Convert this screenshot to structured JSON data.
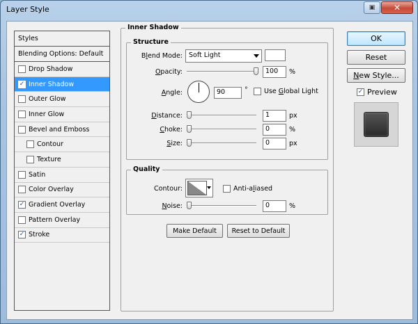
{
  "window": {
    "title": "Layer Style"
  },
  "styles_panel": {
    "header": "Styles",
    "blending": "Blending Options: Default",
    "items": [
      {
        "label": "Drop Shadow",
        "checked": false,
        "selected": false,
        "indent": false
      },
      {
        "label": "Inner Shadow",
        "checked": true,
        "selected": true,
        "indent": false
      },
      {
        "label": "Outer Glow",
        "checked": false,
        "selected": false,
        "indent": false
      },
      {
        "label": "Inner Glow",
        "checked": false,
        "selected": false,
        "indent": false
      },
      {
        "label": "Bevel and Emboss",
        "checked": false,
        "selected": false,
        "indent": false
      },
      {
        "label": "Contour",
        "checked": false,
        "selected": false,
        "indent": true
      },
      {
        "label": "Texture",
        "checked": false,
        "selected": false,
        "indent": true
      },
      {
        "label": "Satin",
        "checked": false,
        "selected": false,
        "indent": false
      },
      {
        "label": "Color Overlay",
        "checked": false,
        "selected": false,
        "indent": false
      },
      {
        "label": "Gradient Overlay",
        "checked": true,
        "selected": false,
        "indent": false
      },
      {
        "label": "Pattern Overlay",
        "checked": false,
        "selected": false,
        "indent": false
      },
      {
        "label": "Stroke",
        "checked": true,
        "selected": false,
        "indent": false
      }
    ]
  },
  "inner_shadow": {
    "title": "Inner Shadow",
    "structure": {
      "title": "Structure",
      "blend_mode_label_pre": "B",
      "blend_mode_label_ul": "l",
      "blend_mode_label_post": "end Mode:",
      "blend_mode_value": "Soft Light",
      "opacity_label_ul": "O",
      "opacity_label_post": "pacity:",
      "opacity_value": "100",
      "opacity_unit": "%",
      "angle_label_ul": "A",
      "angle_label_post": "ngle:",
      "angle_value": "90",
      "angle_unit": "°",
      "global_light_pre": "Use ",
      "global_light_ul": "G",
      "global_light_post": "lobal Light",
      "distance_label_ul": "D",
      "distance_label_post": "istance:",
      "distance_value": "1",
      "distance_unit": "px",
      "choke_label_ul": "C",
      "choke_label_post": "hoke:",
      "choke_value": "0",
      "choke_unit": "%",
      "size_label_ul": "S",
      "size_label_post": "ize:",
      "size_value": "0",
      "size_unit": "px"
    },
    "quality": {
      "title": "Quality",
      "contour_label": "Contour:",
      "anti_aliased_pre": "Anti-a",
      "anti_aliased_ul": "l",
      "anti_aliased_post": "iased",
      "noise_label_ul": "N",
      "noise_label_post": "oise:",
      "noise_value": "0",
      "noise_unit": "%"
    },
    "make_default": "Make Default",
    "reset_default": "Reset to Default"
  },
  "buttons": {
    "ok": "OK",
    "reset": "Reset",
    "new_style_ul": "N",
    "new_style_post": "ew Style...",
    "preview": "Preview"
  }
}
